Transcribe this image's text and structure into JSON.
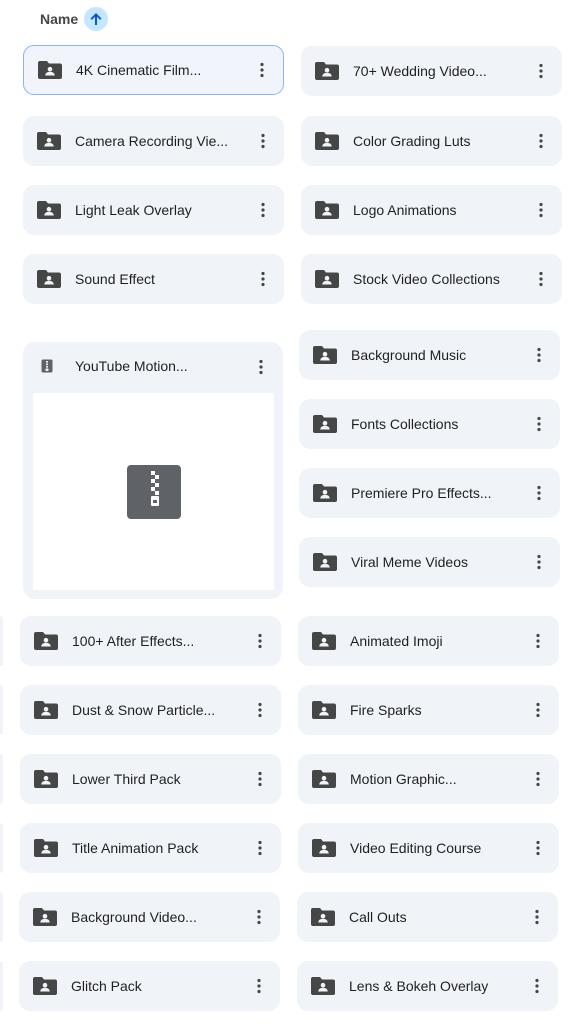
{
  "header": {
    "sort_label": "Name",
    "sort_direction_icon": "arrow-up-icon"
  },
  "colors": {
    "tile_bg": "#f0f4f9",
    "folder_icon": "#444746",
    "selected_border": "#8ab4f8",
    "sort_arrow_bg": "#c2e7ff"
  },
  "items": [
    {
      "label": "4K Cinematic Film...",
      "type": "folder",
      "selected": true
    },
    {
      "label": "70+ Wedding Video...",
      "type": "folder"
    },
    {
      "label": "Camera Recording Vie...",
      "type": "folder"
    },
    {
      "label": "Color Grading Luts",
      "type": "folder"
    },
    {
      "label": "Light Leak Overlay",
      "type": "folder"
    },
    {
      "label": "Logo Animations",
      "type": "folder"
    },
    {
      "label": "Sound Effect",
      "type": "folder"
    },
    {
      "label": "Stock Video Collections",
      "type": "folder"
    },
    {
      "label": "YouTube Motion...",
      "type": "zip"
    },
    {
      "label": "Background Music",
      "type": "folder"
    },
    {
      "label": "Fonts Collections",
      "type": "folder"
    },
    {
      "label": "Premiere Pro Effects...",
      "type": "folder"
    },
    {
      "label": "Viral Meme Videos",
      "type": "folder"
    },
    {
      "label": "100+ After Effects...",
      "type": "folder"
    },
    {
      "label": "Animated Imoji",
      "type": "folder"
    },
    {
      "label": "Dust & Snow Particle...",
      "type": "folder"
    },
    {
      "label": "Fire Sparks",
      "type": "folder"
    },
    {
      "label": "Lower Third Pack",
      "type": "folder"
    },
    {
      "label": "Motion Graphic...",
      "type": "folder"
    },
    {
      "label": "Title Animation Pack",
      "type": "folder"
    },
    {
      "label": "Video Editing Course",
      "type": "folder"
    },
    {
      "label": "Background Video...",
      "type": "folder"
    },
    {
      "label": "Call Outs",
      "type": "folder"
    },
    {
      "label": "Glitch Pack",
      "type": "folder"
    },
    {
      "label": "Lens & Bokeh Overlay",
      "type": "folder"
    }
  ]
}
